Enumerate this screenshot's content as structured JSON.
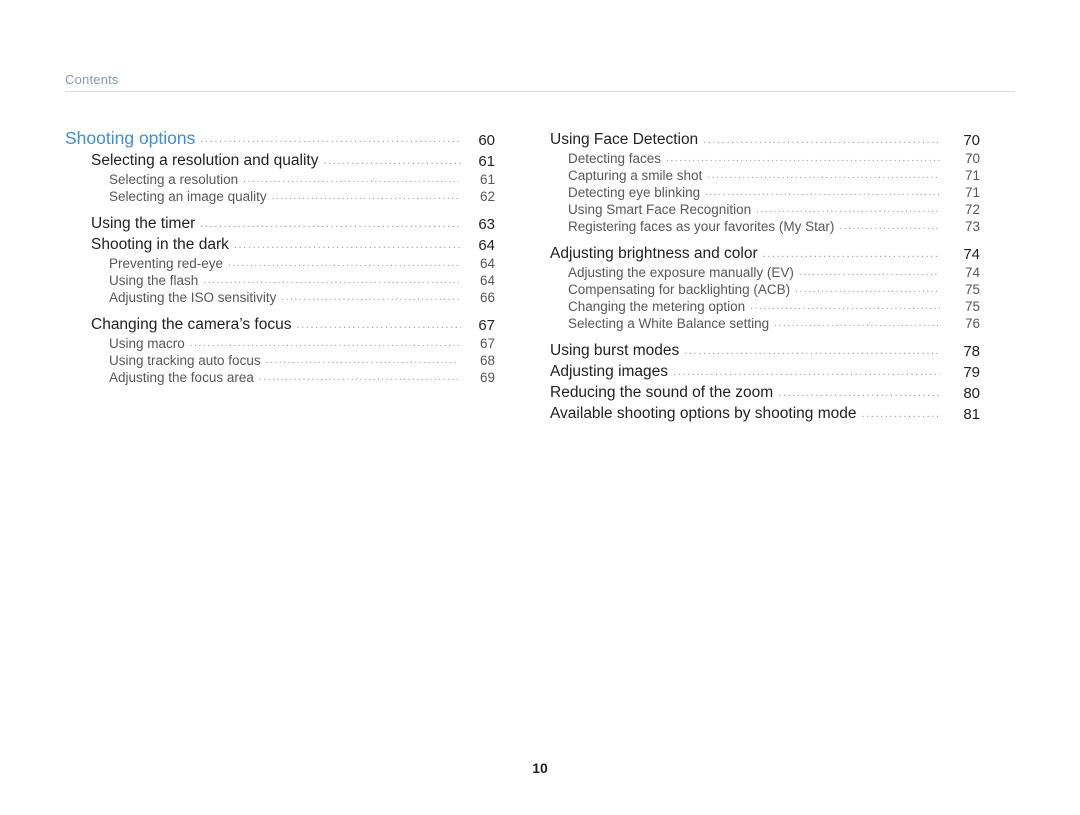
{
  "header": {
    "label": "Contents"
  },
  "footer": {
    "page_number": "10"
  },
  "dots": "................................................................................................................................",
  "left_column": [
    {
      "level": 1,
      "title": "Shooting options",
      "page": "60"
    },
    {
      "level": 2,
      "title": "Selecting a resolution and quality",
      "page": "61"
    },
    {
      "level": 3,
      "title": "Selecting a resolution",
      "page": "61"
    },
    {
      "level": 3,
      "title": "Selecting an image quality",
      "page": "62"
    },
    {
      "level": 2,
      "title": "Using the timer",
      "page": "63"
    },
    {
      "level": 2,
      "title": "Shooting in the dark",
      "page": "64"
    },
    {
      "level": 3,
      "title": "Preventing red-eye",
      "page": "64"
    },
    {
      "level": 3,
      "title": "Using the flash",
      "page": "64"
    },
    {
      "level": 3,
      "title": "Adjusting the ISO sensitivity",
      "page": "66"
    },
    {
      "level": 2,
      "title": "Changing the camera’s focus",
      "page": "67"
    },
    {
      "level": 3,
      "title": "Using macro",
      "page": "67"
    },
    {
      "level": 3,
      "title": "Using tracking auto focus",
      "page": "68"
    },
    {
      "level": 3,
      "title": "Adjusting the focus area",
      "page": "69"
    }
  ],
  "right_column": [
    {
      "level": 2,
      "title": "Using Face Detection",
      "page": "70"
    },
    {
      "level": 3,
      "title": "Detecting faces",
      "page": "70"
    },
    {
      "level": 3,
      "title": "Capturing a smile shot",
      "page": "71"
    },
    {
      "level": 3,
      "title": "Detecting eye blinking",
      "page": "71"
    },
    {
      "level": 3,
      "title": "Using Smart Face Recognition",
      "page": "72"
    },
    {
      "level": 3,
      "title": "Registering faces as your favorites (My Star)",
      "page": "73"
    },
    {
      "level": 2,
      "title": "Adjusting brightness and color",
      "page": "74"
    },
    {
      "level": 3,
      "title": "Adjusting the exposure manually (EV)",
      "page": "74"
    },
    {
      "level": 3,
      "title": "Compensating for backlighting (ACB)",
      "page": "75"
    },
    {
      "level": 3,
      "title": "Changing the metering option",
      "page": "75"
    },
    {
      "level": 3,
      "title": "Selecting a White Balance setting",
      "page": "76"
    },
    {
      "level": 2,
      "title": "Using burst modes",
      "page": "78"
    },
    {
      "level": 2,
      "title": "Adjusting images",
      "page": "79"
    },
    {
      "level": 2,
      "title": "Reducing the sound of the zoom",
      "page": "80"
    },
    {
      "level": 2,
      "title": "Available shooting options by shooting mode",
      "page": "81"
    }
  ]
}
